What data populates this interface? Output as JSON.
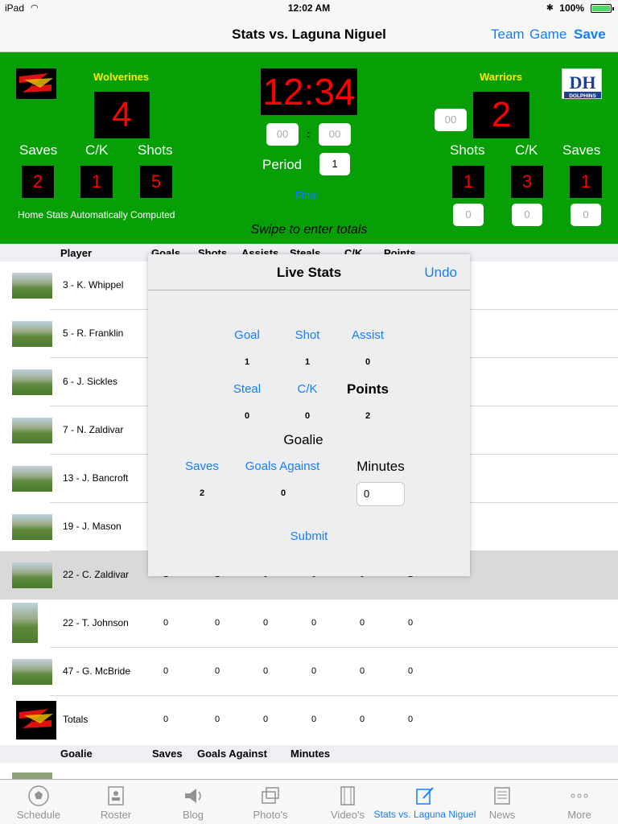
{
  "status_bar": {
    "device": "iPad",
    "time": "12:02 AM",
    "battery": "100%",
    "battery_level": 1.0,
    "battery_color": "#4cd964"
  },
  "nav": {
    "title": "Stats vs. Laguna Niguel",
    "buttons": [
      "Team",
      "Game",
      "Save"
    ]
  },
  "scoreboard": {
    "background_color": "#06a006",
    "home": {
      "name": "Wolverines",
      "score": "4",
      "saves": "2",
      "ck": "1",
      "shots": "5",
      "note": "Home Stats Automatically Computed"
    },
    "away": {
      "name": "Warriors",
      "score": "2",
      "extra_field": "00",
      "logo_text": "DH",
      "logo_sub": "DOLPHINS",
      "shots": "1",
      "ck": "3",
      "saves": "1",
      "shots_entry": "0",
      "ck_entry": "0",
      "saves_entry": "0"
    },
    "clock": "12:34",
    "clock_min_field": "00",
    "clock_sec_field": "00",
    "colon": ":",
    "period_label": "Period",
    "period_value": "1",
    "final_label": "Final",
    "labels": {
      "saves": "Saves",
      "ck": "C/K",
      "shots": "Shots"
    },
    "swipe_hint": "Swipe to enter totals"
  },
  "table": {
    "columns": [
      "Player",
      "Goals",
      "Shots",
      "Assists",
      "Steals",
      "C/K",
      "Points"
    ],
    "rows": [
      {
        "name": "3 - K. Whippel",
        "values": [
          "",
          "",
          "",
          "",
          "",
          ""
        ]
      },
      {
        "name": "5 - R. Franklin",
        "values": [
          "",
          "",
          "",
          "",
          "",
          ""
        ]
      },
      {
        "name": "6 - J. Sickles",
        "values": [
          "",
          "",
          "",
          "",
          "",
          ""
        ]
      },
      {
        "name": "7 - N. Zaldivar",
        "values": [
          "",
          "",
          "",
          "",
          "",
          ""
        ]
      },
      {
        "name": "13 - J. Bancroft",
        "values": [
          "",
          "",
          "",
          "",
          "",
          ""
        ]
      },
      {
        "name": "19 - J. Mason",
        "values": [
          "",
          "",
          "",
          "",
          "",
          ""
        ]
      },
      {
        "name": "22 - C. Zaldivar",
        "values": [
          "1",
          "1",
          "0",
          "0",
          "0",
          "2"
        ]
      },
      {
        "name": "22 - T. Johnson",
        "values": [
          "0",
          "0",
          "0",
          "0",
          "0",
          "0"
        ]
      },
      {
        "name": "47 - G. McBride",
        "values": [
          "0",
          "0",
          "0",
          "0",
          "0",
          "0"
        ]
      },
      {
        "name": "Totals",
        "values": [
          "0",
          "0",
          "0",
          "0",
          "0",
          "0"
        ]
      }
    ],
    "goalie_columns": [
      "Goalie",
      "Saves",
      "Goals Against",
      "Minutes"
    ]
  },
  "popover": {
    "title": "Live Stats",
    "undo": "Undo",
    "goal": "Goal",
    "goal_val": "1",
    "shot": "Shot",
    "shot_val": "1",
    "assist": "Assist",
    "assist_val": "0",
    "steal": "Steal",
    "steal_val": "0",
    "ck": "C/K",
    "ck_val": "0",
    "points": "Points",
    "points_val": "2",
    "goalie": "Goalie",
    "saves": "Saves",
    "saves_val": "2",
    "goals_against": "Goals Against",
    "goals_against_val": "0",
    "minutes": "Minutes",
    "minutes_val": "0",
    "submit": "Submit"
  },
  "tabs": [
    {
      "label": "Schedule",
      "icon": "soccer-ball-icon"
    },
    {
      "label": "Roster",
      "icon": "roster-icon"
    },
    {
      "label": "Blog",
      "icon": "megaphone-icon"
    },
    {
      "label": "Photo's",
      "icon": "photos-icon"
    },
    {
      "label": "Video's",
      "icon": "film-icon"
    },
    {
      "label": "Stats vs. Laguna Niguel",
      "icon": "edit-icon",
      "active": true
    },
    {
      "label": "News",
      "icon": "newspaper-icon"
    },
    {
      "label": "More",
      "icon": "more-icon"
    }
  ],
  "accent_color": "#147efb"
}
